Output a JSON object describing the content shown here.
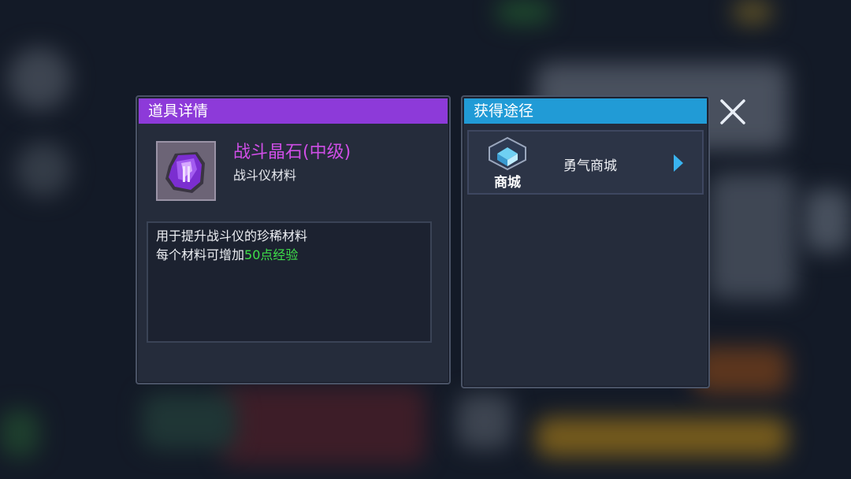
{
  "detail": {
    "title": "道具详情",
    "item_name": "战斗晶石(中级)",
    "item_type": "战斗仪材料",
    "description_line1": "用于提升战斗仪的珍稀材料",
    "description_line2_prefix": "每个材料可增加",
    "description_line2_highlight": "50点经验",
    "icon": "purple-crystal-icon"
  },
  "source": {
    "title": "获得途径",
    "items": [
      {
        "icon_label": "商城",
        "label": "勇气商城",
        "icon": "shop-icon"
      }
    ]
  },
  "close": {
    "icon": "close-icon"
  },
  "colors": {
    "detail_header": "#8d3ad9",
    "source_header": "#219bd6",
    "item_name": "#cf4ee6",
    "highlight": "#3fe04a",
    "arrow": "#39b3ef"
  }
}
